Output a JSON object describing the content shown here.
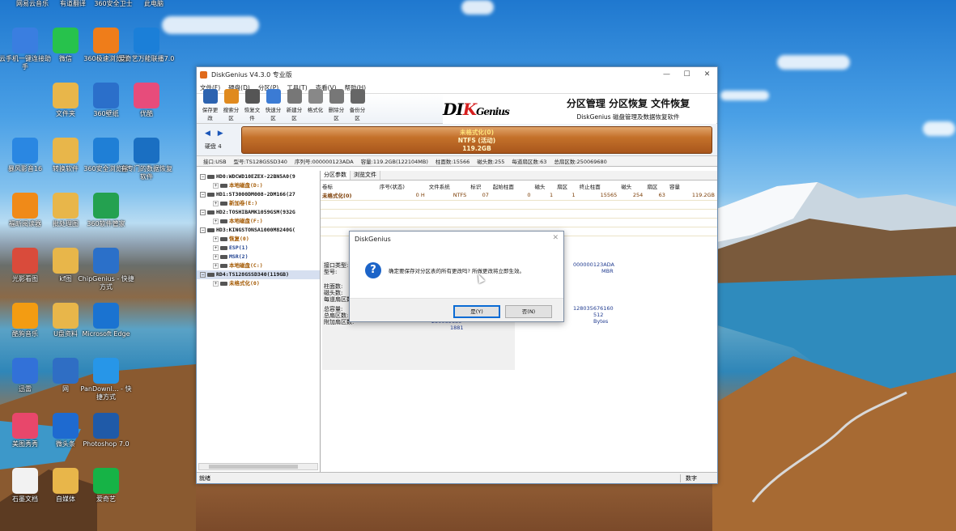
{
  "desktop": {
    "top_labels": [
      "网易云音乐",
      "有道翻译",
      "360安全卫士",
      "此电脑"
    ],
    "icons": [
      {
        "name": "kuaichuan-icon",
        "label": "云手机一键连接助手",
        "color": "#3a7ee0"
      },
      {
        "name": "wechat-icon",
        "label": "微信",
        "color": "#27c24c"
      },
      {
        "name": "browser360-icon",
        "label": "360极速浏览器",
        "color": "#ef7d1a"
      },
      {
        "name": "youyou-icon",
        "label": "爱奇艺万能联播7.0",
        "color": "#1b7fd8"
      },
      {
        "name": "folder-icon",
        "label": "文件夹",
        "color": "#e8b64a"
      },
      {
        "name": "folder-icon",
        "label": "360壁纸",
        "color": "#2b6fca"
      },
      {
        "name": "bilibili-icon",
        "label": "优酷",
        "color": "#e74c7b"
      },
      {
        "name": "kuai-icon",
        "label": "暴风影音16",
        "color": "#2a87e2"
      },
      {
        "name": "folder-icon",
        "label": "转换软件",
        "color": "#e8b64a"
      },
      {
        "name": "360-icon",
        "label": "360安全浏览器",
        "color": "#1f7fd6"
      },
      {
        "name": "yc-icon",
        "label": "有专门的数据恢复软件",
        "color": "#1a6fc2"
      },
      {
        "name": "reader-icon",
        "label": "福昕阅读器",
        "color": "#f08a18"
      },
      {
        "name": "folder-icon",
        "label": "批处理图",
        "color": "#e8b64a"
      },
      {
        "name": "apps360-icon",
        "label": "360软件管家",
        "color": "#24a150"
      },
      {
        "name": "color-icon",
        "label": "光影看图",
        "color": "#d94b3b"
      },
      {
        "name": "folder-icon",
        "label": "kf图",
        "color": "#e8b64a"
      },
      {
        "name": "chipgenius-icon",
        "label": "ChipGenius - 快捷方式",
        "color": "#2b70c9"
      },
      {
        "name": "kugou-icon",
        "label": "酷狗音乐",
        "color": "#f39c12"
      },
      {
        "name": "folder-icon",
        "label": "U盘资料",
        "color": "#e8b64a"
      },
      {
        "name": "edge-icon",
        "label": "Microsoft Edge",
        "color": "#1a73d1"
      },
      {
        "name": "game-icon",
        "label": "迅雷",
        "color": "#3271d8"
      },
      {
        "name": "network-icon",
        "label": "网",
        "color": "#2f6ec4"
      },
      {
        "name": "pandownload-icon",
        "label": "PanDownl... - 快捷方式",
        "color": "#2796e8"
      },
      {
        "name": "meitu-icon",
        "label": "美图秀秀",
        "color": "#e8476b"
      },
      {
        "name": "cloud-icon",
        "label": "微头条",
        "color": "#1e6ad0"
      },
      {
        "name": "photoshop-icon",
        "label": "Photoshop 7.0",
        "color": "#1f5aa8"
      },
      {
        "name": "shitou-icon",
        "label": "石墨文档",
        "color": "#f2f2f2"
      },
      {
        "name": "folder-icon",
        "label": "自媒体",
        "color": "#e8b64a"
      },
      {
        "name": "iqiyi-icon",
        "label": "爱奇艺",
        "color": "#16b346"
      }
    ]
  },
  "window": {
    "title": "DiskGenius V4.3.0 专业版",
    "controls": [
      "—",
      "☐",
      "✕"
    ],
    "menu": [
      "文件(F)",
      "硬盘(D)",
      "分区(P)",
      "工具(T)",
      "查看(V)",
      "帮助(H)"
    ],
    "toolbar": [
      {
        "label": "保存更改",
        "icon": "save-icon",
        "color": "#2c63b0"
      },
      {
        "label": "搜索分区",
        "icon": "search-icon",
        "color": "#e08a1e"
      },
      {
        "label": "恢复文件",
        "icon": "recover-icon",
        "color": "#555555"
      },
      {
        "label": "快速分区",
        "icon": "quick-partition-icon",
        "color": "#3b7bd4"
      },
      {
        "label": "新建分区",
        "icon": "new-partition-icon",
        "color": "#777777"
      },
      {
        "label": "格式化",
        "icon": "format-icon",
        "color": "#888888"
      },
      {
        "label": "删除分区",
        "icon": "delete-icon",
        "color": "#777777"
      },
      {
        "label": "备份分区",
        "icon": "backup-icon",
        "color": "#666666"
      }
    ],
    "banner": {
      "brand_a": "DI",
      "brand_b": "K",
      "brand_c": "Genius",
      "slogan": "分区管理 分区恢复 文件恢复",
      "subtitle": "DiskGenius 磁盘管理及数据恢复软件"
    },
    "disk_label": "硬盘 4",
    "partition_bar": {
      "line1": "未格式化(0)",
      "line2": "NTFS (活动)",
      "line3": "119.2GB"
    },
    "info_line": [
      "接口:USB",
      "型号:TS128GSSD340",
      "序列号:000000123ADA",
      "容量:119.2GB(122104MB)",
      "柱面数:15566",
      "磁头数:255",
      "每道扇区数:63",
      "总扇区数:250069680"
    ],
    "tree": [
      {
        "text": "HD0:WDCWD10EZEX-22BN5A0(9",
        "type": "disk"
      },
      {
        "text": "本地磁盘(D:)",
        "type": "child"
      },
      {
        "text": "HD1:ST3000DM008-2DM166(27",
        "type": "disk"
      },
      {
        "text": "新加卷(E:)",
        "type": "child"
      },
      {
        "text": "HD2:TOSHIBAMK1059GSM(932G",
        "type": "disk"
      },
      {
        "text": "本地磁盘(F:)",
        "type": "child"
      },
      {
        "text": "HD3:KINGSTONSA1000M8240G(",
        "type": "disk"
      },
      {
        "text": "恢复(0)",
        "type": "child"
      },
      {
        "text": "ESP(1)",
        "type": "child2"
      },
      {
        "text": "MSR(2)",
        "type": "child2"
      },
      {
        "text": "本地磁盘(C:)",
        "type": "child"
      },
      {
        "text": "RD4:TS128GSSD340(119GB)",
        "type": "disk",
        "selected": true
      },
      {
        "text": "未格式化(0)",
        "type": "child"
      }
    ],
    "tabs": [
      "分区参数",
      "浏览文件"
    ],
    "table_headers": [
      "卷标",
      "序号(状态)",
      "文件系统",
      "标识",
      "起始柱面",
      "磁头",
      "扇区",
      "终止柱面",
      "磁头",
      "扇区",
      "容量"
    ],
    "table_rows": [
      [
        "未格式化(0)",
        "0 H",
        "NTFS",
        "07",
        "0",
        "1",
        "1",
        "15565",
        "254",
        "63",
        "119.2GB"
      ]
    ],
    "lower_labels": [
      "接口类型:",
      "型号:",
      "柱面数:",
      "磁头数:",
      "每道扇区数:",
      "总容量:",
      "总扇区数:",
      "附加扇区数:"
    ],
    "lower_values": [
      "000000123ADA",
      "MBR",
      "128035676160",
      "512 Bytes",
      "250069680",
      "1881"
    ],
    "status_left": "就绪",
    "status_right": "数字"
  },
  "dialog": {
    "title": "DiskGenius",
    "close": "✕",
    "message": "确定要保存对分区表的所有更改吗? 所做更改将立即生效。",
    "yes_label": "是(Y)",
    "no_label": "否(N)"
  }
}
